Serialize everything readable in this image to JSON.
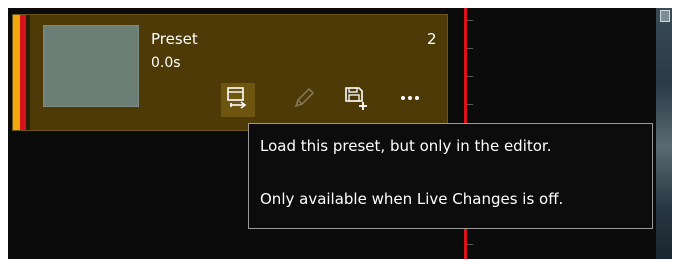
{
  "preset": {
    "title": "Preset",
    "duration": "0.0s",
    "count": "2"
  },
  "actions": {
    "load_icon": "load-preset-icon",
    "edit_icon": "pencil-icon",
    "save_icon": "save-new-icon",
    "more_icon": "more-icon"
  },
  "tooltip": {
    "line1": "Load this preset, but only in the editor.",
    "line2": "Only available when Live Changes is off."
  },
  "colors": {
    "card_bg": "#4d3a06",
    "accent_yellow": "#f2a80a",
    "accent_red": "#d8131c",
    "playhead": "#d8131c"
  }
}
